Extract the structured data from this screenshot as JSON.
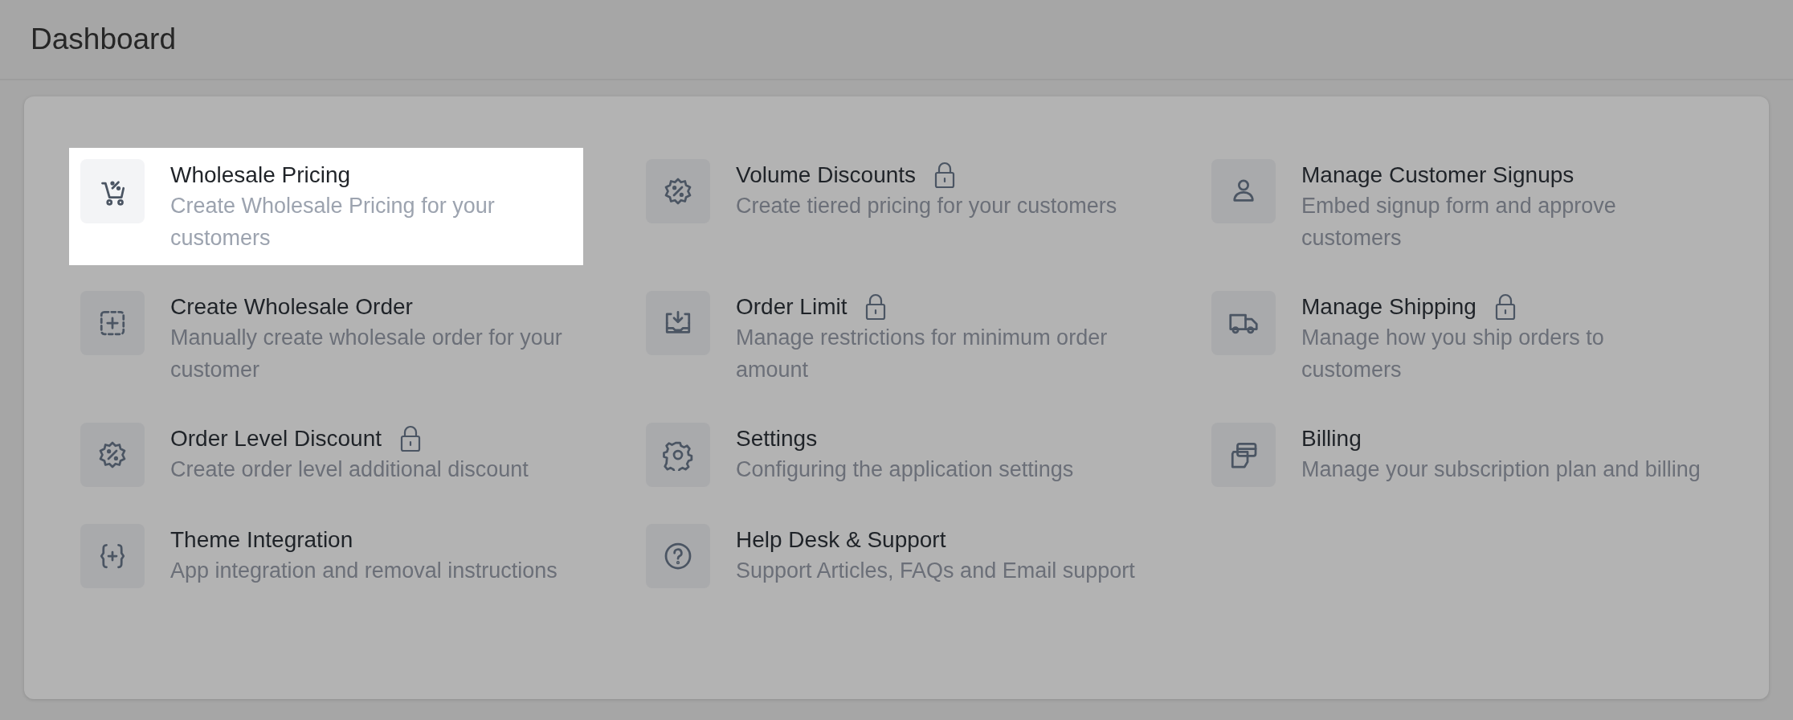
{
  "header": {
    "title": "Dashboard"
  },
  "items": [
    {
      "title": "Wholesale Pricing",
      "description": "Create Wholesale Pricing for your customers",
      "locked": false,
      "selected": true
    },
    {
      "title": "Volume Discounts",
      "description": "Create tiered pricing for your customers",
      "locked": true,
      "selected": false
    },
    {
      "title": "Manage Customer Signups",
      "description": "Embed signup form and approve customers",
      "locked": false,
      "selected": false
    },
    {
      "title": "Create Wholesale Order",
      "description": "Manually create wholesale order for your customer",
      "locked": false,
      "selected": false
    },
    {
      "title": "Order Limit",
      "description": "Manage restrictions for minimum order amount",
      "locked": true,
      "selected": false
    },
    {
      "title": "Manage Shipping",
      "description": "Manage how you ship orders to customers",
      "locked": true,
      "selected": false
    },
    {
      "title": "Order Level Discount",
      "description": "Create order level additional discount",
      "locked": true,
      "selected": false
    },
    {
      "title": "Settings",
      "description": "Configuring the application settings",
      "locked": false,
      "selected": false
    },
    {
      "title": "Billing",
      "description": "Manage your subscription plan and billing",
      "locked": false,
      "selected": false
    },
    {
      "title": "Theme Integration",
      "description": "App integration and removal instructions",
      "locked": false,
      "selected": false
    },
    {
      "title": "Help Desk & Support",
      "description": "Support Articles, FAQs and Email support",
      "locked": false,
      "selected": false
    }
  ]
}
